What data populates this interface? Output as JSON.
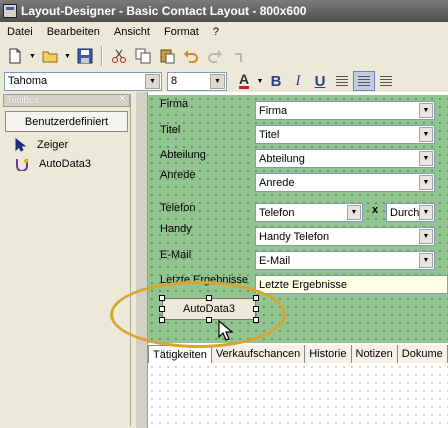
{
  "window": {
    "title": "Layout-Designer - Basic Contact Layout - 800x600"
  },
  "menu": [
    "Datei",
    "Bearbeiten",
    "Ansicht",
    "Format",
    "?"
  ],
  "toolbar": {
    "icons": [
      "new-icon",
      "open-icon",
      "save-icon",
      "cut-icon",
      "copy-icon",
      "paste-icon",
      "undo-icon",
      "redo-icon"
    ]
  },
  "format_bar": {
    "font": "Tahoma",
    "size": "8",
    "bold": "B",
    "italic": "I",
    "underline": "U",
    "color_letter": "A",
    "pressed": "align-center"
  },
  "toolbox": {
    "header": "ToolBox",
    "button": "Benutzerdefiniert",
    "items": [
      {
        "label": "Zeiger",
        "icon": "pointer-arrow-icon"
      },
      {
        "label": "AutoData3",
        "icon": "autodata-icon"
      }
    ]
  },
  "form": {
    "fields": [
      {
        "label": "Firma",
        "value": "Firma"
      },
      {
        "label": "Titel",
        "value": "Titel"
      },
      {
        "label": "Abteilung",
        "value": "Abteilung"
      },
      {
        "label": "Anrede",
        "value": "Anrede"
      },
      {
        "label": "Telefon",
        "value": "Telefon"
      },
      {
        "label": "Handy",
        "value": "Handy Telefon"
      },
      {
        "label": "E-Mail",
        "value": "E-Mail"
      },
      {
        "label": "Letzte Ergebnisse",
        "value": "Letzte Ergebnisse"
      }
    ],
    "phone_extra": {
      "separator": "x",
      "value": "Durch"
    },
    "selected_control": "AutoData3"
  },
  "tabs": [
    "Tätigkeiten",
    "Verkaufschancen",
    "Historie",
    "Notizen",
    "Dokume"
  ],
  "colors": {
    "form_bg": "#92c48f",
    "highlight_ring": "#d9a531",
    "title_bar": "#5e5e5e"
  }
}
